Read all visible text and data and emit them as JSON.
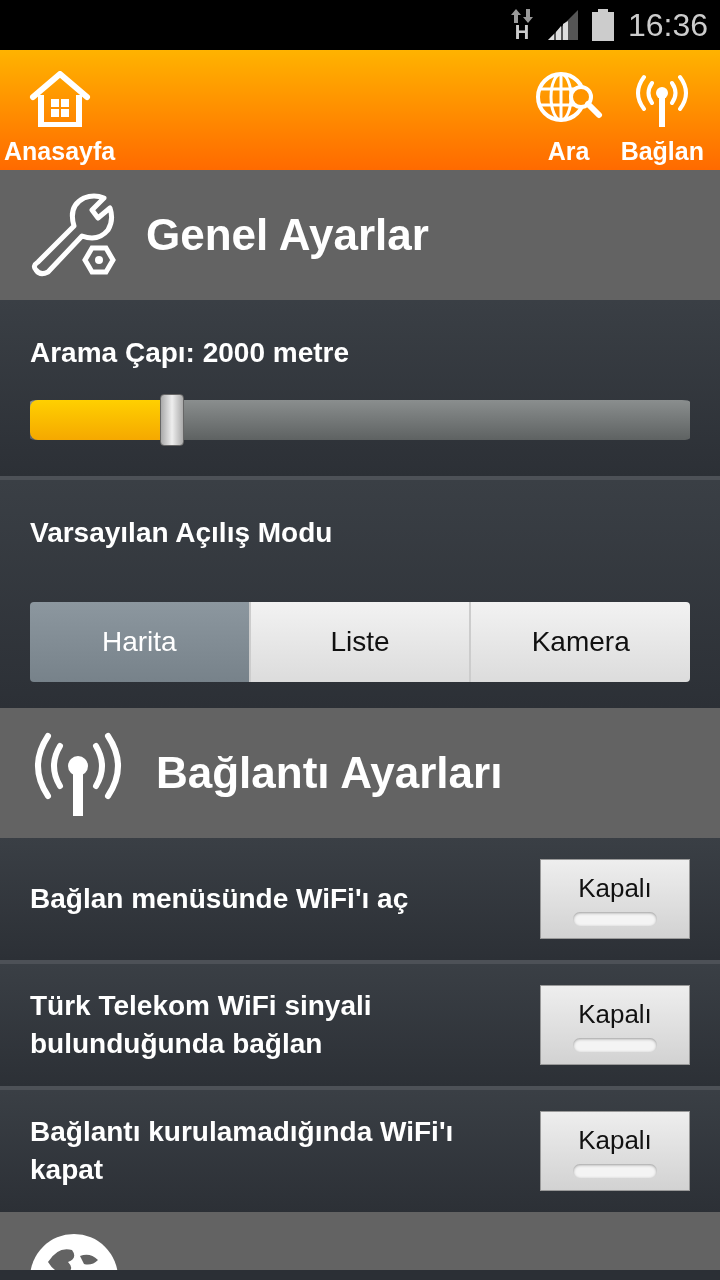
{
  "status_bar": {
    "network": "H",
    "time": "16:36"
  },
  "toolbar": {
    "left": [
      {
        "kind": "home",
        "label": "Anasayfa"
      }
    ],
    "right": [
      {
        "kind": "search",
        "label": "Ara"
      },
      {
        "kind": "antenna",
        "label": "Bağlan"
      }
    ]
  },
  "sections": [
    {
      "kind": "tools",
      "title": "Genel Ayarlar",
      "settings": [
        {
          "kind": "slider",
          "label": "Arama Çapı: 2000 metre",
          "level": 0.215
        },
        {
          "kind": "segmented",
          "label": "Varsayılan Açılış Modu",
          "options": [
            {
              "label": "Harita",
              "selected": true
            },
            {
              "label": "Liste",
              "selected": false
            },
            {
              "label": "Kamera",
              "selected": false
            }
          ]
        }
      ]
    },
    {
      "kind": "antenna",
      "title": "Bağlantı Ayarları",
      "settings": [
        {
          "kind": "toggle",
          "label": "Bağlan menüsünde WiFi'ı aç",
          "button": "Kapalı",
          "on": false
        },
        {
          "kind": "toggle",
          "label": "Türk Telekom WiFi sinyali bulunduğunda bağlan",
          "button": "Kapalı",
          "on": false
        },
        {
          "kind": "toggle",
          "label": "Bağlantı kurulamadığında WiFi'ı kapat",
          "button": "Kapalı",
          "on": false
        }
      ]
    },
    {
      "kind": "globe"
    }
  ]
}
